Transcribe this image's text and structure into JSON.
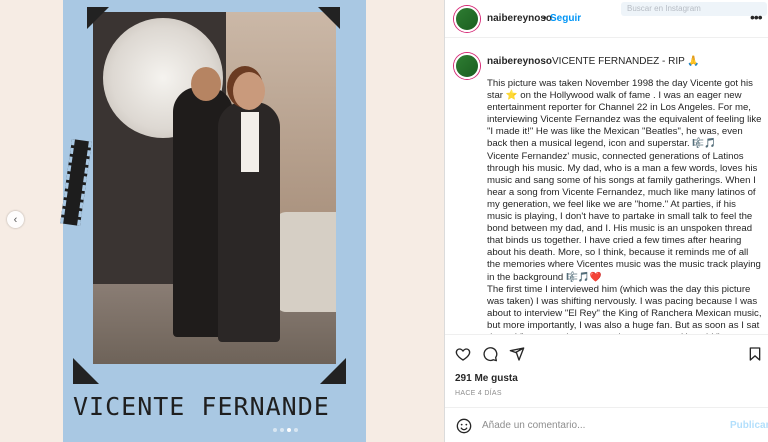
{
  "carousel": {
    "prev_icon": "chevron-left-icon",
    "caption": "VICENTE FERNANDE",
    "dots": [
      false,
      false,
      true,
      false
    ]
  },
  "header": {
    "username": "naibereynoso",
    "separator": "•",
    "follow_label": "Seguir",
    "more_icon": "•••",
    "search_placeholder": "Buscar en Instagram"
  },
  "post": {
    "username": "naibereynoso",
    "title": "VICENTE FERNANDEZ - RIP 🙏",
    "paragraphs": [
      "This picture was taken November 1998 the day Vicente got his star ⭐ on the Hollywood walk of fame . I was an eager new entertainment reporter for Channel 22 in Los Angeles. For me, interviewing Vicente Fernandez was the equivalent of feeling like \"I made it!\" He was like the Mexican \"Beatles\", he was, even back then a musical legend, icon and superstar. 🎼🎵",
      "Vicente Fernandez' music, connected generations of Latinos through his music. My dad, who is a man a few words, loves his music and sang some of his songs at family gatherings. When I hear a song from Vicente Fernandez, much like many latinos of my generation, we feel like we are \"home.\" At parties, if his music is playing, I don't have to partake in small talk to feel the bond between my dad, and I. His music is an unspoken thread that binds us together. I have cried a few times after hearing about his death. More, so I think, because it reminds me of all the memories where Vicentes music was the music track playing in the background 🎼🎵❤️",
      "The first time I interviewed him (which was the day this picture was taken) I was shifting nervously. I was pacing because I was about to interview \"El Rey\" the King of Ranchera Mexican music, but more importantly, I was also a huge fan. But as soon as I sat down, Vicente made sure to calm my nerves. He said \"tu ya conociendo"
    ]
  },
  "actions": {
    "like_icon": "heart-icon",
    "comment_icon": "comment-icon",
    "share_icon": "send-icon",
    "save_icon": "bookmark-icon",
    "likes": "291 Me gusta",
    "time": "HACE 4 DÍAS"
  },
  "comment": {
    "emoji_icon": "smiley-icon",
    "placeholder": "Añade un comentario...",
    "publish_label": "Publicar"
  }
}
